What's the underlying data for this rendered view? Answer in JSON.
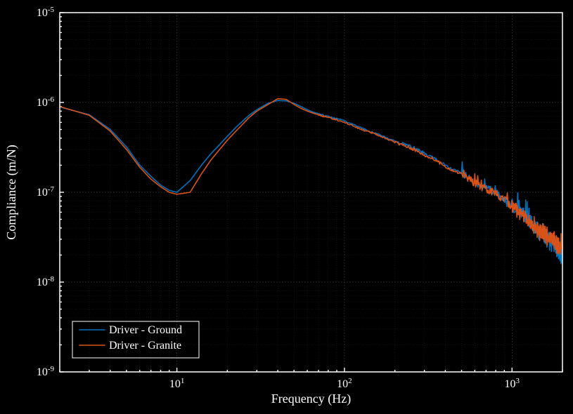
{
  "chart_data": {
    "type": "line",
    "xlabel": "Frequency (Hz)",
    "ylabel": "Compliance (m/N)",
    "xscale": "log",
    "yscale": "log",
    "xlim": [
      2,
      2000
    ],
    "ylim": [
      1e-09,
      1e-05
    ],
    "x_ticks": [
      2,
      10,
      100,
      1000,
      2000
    ],
    "x_tick_labels": [
      "",
      "10^1",
      "10^2",
      "10^3",
      ""
    ],
    "y_ticks": [
      1e-09,
      1e-08,
      1e-07,
      1e-06,
      1e-05
    ],
    "y_tick_labels": [
      "10^{-9}",
      "10^{-8}",
      "10^{-7}",
      "10^{-6}",
      "10^{-5}"
    ],
    "series": [
      {
        "name": "Driver - Ground",
        "color": "#0072bd",
        "x": [
          2,
          3,
          4,
          5,
          6,
          7,
          8,
          9,
          10,
          12,
          14,
          16,
          18,
          20,
          23,
          27,
          30,
          35,
          40,
          45,
          50,
          55,
          60,
          65,
          70,
          75,
          80,
          85,
          90,
          100,
          110,
          120,
          130,
          140,
          150,
          160,
          170,
          180,
          200,
          220,
          240,
          260,
          280,
          300,
          330,
          360,
          400,
          440,
          480,
          520,
          560,
          600,
          650,
          700,
          750,
          800,
          850,
          900,
          950,
          1000,
          1050,
          1100,
          1150,
          1200,
          1250,
          1300,
          1350,
          1400,
          1450,
          1500,
          1550,
          1600,
          1650,
          1700,
          1750,
          1800,
          1850,
          1900,
          1950,
          2000
        ],
        "y": [
          8.9e-07,
          7.3e-07,
          5e-07,
          3.2e-07,
          2e-07,
          1.5e-07,
          1.2e-07,
          1.05e-07,
          1e-07,
          1.35e-07,
          2e-07,
          2.7e-07,
          3.4e-07,
          4.2e-07,
          5.5e-07,
          7.2e-07,
          8.3e-07,
          9.8e-07,
          1.05e-06,
          1.04e-06,
          9.8e-07,
          9e-07,
          8.3e-07,
          7.8e-07,
          7.5e-07,
          7.2e-07,
          7e-07,
          6.8e-07,
          6.6e-07,
          6.2e-07,
          5.8e-07,
          5.4e-07,
          5.1e-07,
          4.8e-07,
          4.6e-07,
          4.4e-07,
          4.2e-07,
          4e-07,
          3.7e-07,
          3.5e-07,
          3.3e-07,
          3.1e-07,
          2.9e-07,
          2.7e-07,
          2.5e-07,
          2.3e-07,
          2e-07,
          1.8e-07,
          1.7e-07,
          1.55e-07,
          1.4e-07,
          1.28e-07,
          1.18e-07,
          1.1e-07,
          1.05e-07,
          9.8e-08,
          9e-08,
          8.4e-08,
          7.8e-08,
          7.2e-08,
          6.6e-08,
          6.2e-08,
          5.8e-08,
          5.4e-08,
          5e-08,
          4.6e-08,
          4.2e-08,
          3.9e-08,
          3.6e-08,
          3.4e-08,
          3.2e-08,
          3e-08,
          2.9e-08,
          2.8e-08,
          2.7e-08,
          2.6e-08,
          2.3e-08,
          2.2e-08,
          2e-08,
          1.9e-08
        ]
      },
      {
        "name": "Driver - Granite",
        "color": "#d95319",
        "x": [
          2,
          3,
          4,
          5,
          6,
          7,
          8,
          9,
          10,
          12,
          14,
          16,
          18,
          20,
          23,
          27,
          30,
          35,
          40,
          45,
          50,
          55,
          60,
          65,
          70,
          75,
          80,
          85,
          90,
          100,
          110,
          120,
          130,
          140,
          150,
          160,
          170,
          180,
          200,
          220,
          240,
          260,
          280,
          300,
          330,
          360,
          400,
          440,
          480,
          520,
          560,
          600,
          650,
          700,
          750,
          800,
          850,
          900,
          950,
          1000,
          1050,
          1100,
          1150,
          1200,
          1250,
          1300,
          1350,
          1400,
          1450,
          1500,
          1550,
          1600,
          1650,
          1700,
          1750,
          1800,
          1850,
          1900,
          1950,
          2000
        ],
        "y": [
          9e-07,
          7.2e-07,
          4.8e-07,
          3e-07,
          1.9e-07,
          1.4e-07,
          1.15e-07,
          1e-07,
          9.5e-08,
          1e-07,
          1.6e-07,
          2.3e-07,
          3e-07,
          3.8e-07,
          5e-07,
          6.8e-07,
          8e-07,
          9.5e-07,
          1.1e-06,
          1.08e-06,
          9.5e-07,
          8.6e-07,
          8e-07,
          7.6e-07,
          7.3e-07,
          7e-07,
          6.8e-07,
          6.6e-07,
          6.4e-07,
          6e-07,
          5.6e-07,
          5.2e-07,
          4.9e-07,
          4.7e-07,
          4.5e-07,
          4.3e-07,
          4.1e-07,
          3.9e-07,
          3.6e-07,
          3.4e-07,
          3.2e-07,
          3e-07,
          2.8e-07,
          2.6e-07,
          2.4e-07,
          2.2e-07,
          1.95e-07,
          1.75e-07,
          1.65e-07,
          1.5e-07,
          1.37e-07,
          1.26e-07,
          1.16e-07,
          1.08e-07,
          1.03e-07,
          9.6e-08,
          8.8e-08,
          8.2e-08,
          7.6e-08,
          7e-08,
          6.4e-08,
          6e-08,
          5.6e-08,
          5.2e-08,
          4.8e-08,
          4.5e-08,
          4.1e-08,
          3.8e-08,
          3.6e-08,
          3.5e-08,
          3.4e-08,
          3.3e-08,
          3.2e-08,
          3.1e-08,
          3e-08,
          2.9e-08,
          2.6e-08,
          2.5e-08,
          2.4e-08,
          2.3e-08
        ]
      }
    ],
    "legend_position": "lower-left"
  },
  "legend_labels": {
    "0": "Driver - Ground",
    "1": "Driver - Granite"
  },
  "colors": {
    "series0": "#0072bd",
    "series1": "#d95319"
  }
}
